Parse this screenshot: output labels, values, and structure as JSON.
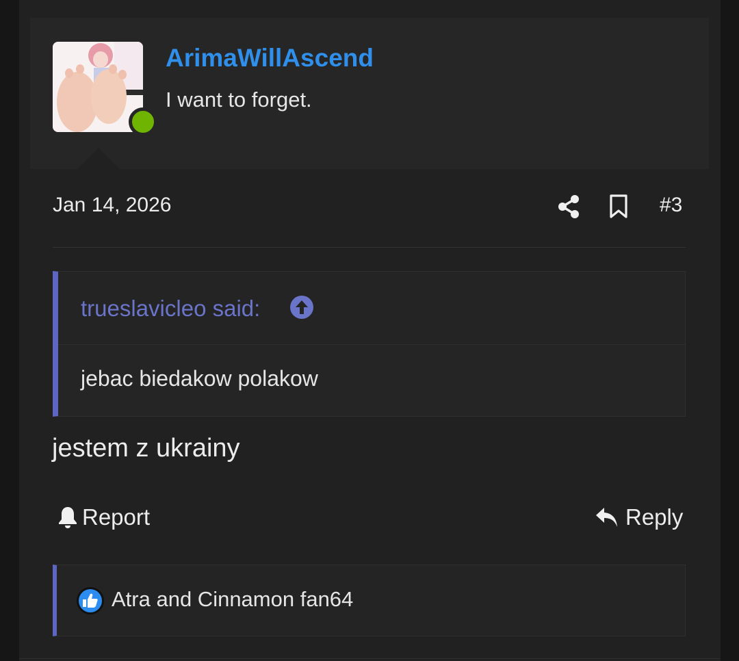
{
  "user": {
    "name": "ArimaWillAscend",
    "title": "I want to forget.",
    "status": "online"
  },
  "post": {
    "date": "Jan 14, 2026",
    "number": "#3",
    "message": "jestem z ukrainy"
  },
  "quote": {
    "author": "trueslavicleo said:",
    "body": "jebac biedakow polakow"
  },
  "actions": {
    "report_label": "Report",
    "reply_label": "Reply"
  },
  "reactions": {
    "users": "Atra and Cinnamon fan64"
  },
  "colors": {
    "username": "#2f8fea",
    "quote_accent": "#5d66c2",
    "online": "#6fb400",
    "background": "#212121"
  },
  "icons": [
    "share-icon",
    "bookmark-icon",
    "arrow-up-circle-icon",
    "bell-icon",
    "reply-arrow-icon",
    "thumbs-up-icon"
  ]
}
